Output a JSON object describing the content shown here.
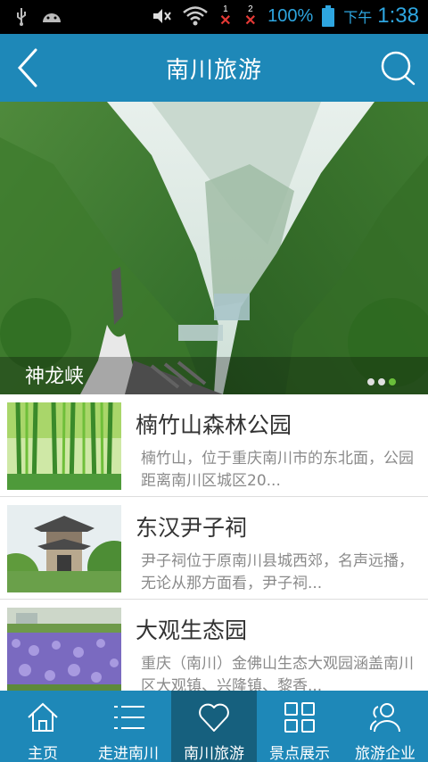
{
  "status_bar": {
    "sim1": "1",
    "sim2": "2",
    "battery": "100%",
    "afternoon": "下午",
    "time": "1:38"
  },
  "header": {
    "title": "南川旅游"
  },
  "banner": {
    "caption": "神龙峡",
    "dots": 3,
    "active_dot": 3
  },
  "list": [
    {
      "title": "楠竹山森林公园",
      "desc": "楠竹山，位于重庆南川市的东北面，公园距离南川区城区20..."
    },
    {
      "title": "东汉尹子祠",
      "desc": "尹子祠位于原南川县城西郊，名声远播，无论从那方面看，尹子祠..."
    },
    {
      "title": "大观生态园",
      "desc": "重庆（南川）金佛山生态大观园涵盖南川区大观镇、兴隆镇、黎香..."
    }
  ],
  "bottom_nav": [
    {
      "label": "主页",
      "icon": "home-icon"
    },
    {
      "label": "走进南川",
      "icon": "list-icon"
    },
    {
      "label": "南川旅游",
      "icon": "heart-icon",
      "active": true
    },
    {
      "label": "景点展示",
      "icon": "grid-icon"
    },
    {
      "label": "旅游企业",
      "icon": "users-icon"
    }
  ],
  "colors": {
    "primary": "#1e88b8",
    "active_tab": "#16607e",
    "status_accent": "#2ea6e0"
  }
}
